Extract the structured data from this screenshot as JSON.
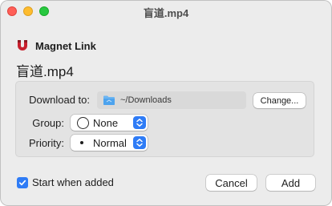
{
  "window": {
    "title": "盲道.mp4"
  },
  "header": {
    "icon": "magnet-icon",
    "title": "Magnet Link"
  },
  "file": {
    "name": "盲道.mp4"
  },
  "download": {
    "label": "Download to:",
    "icon": "folder-icon",
    "path": "~/Downloads",
    "change_label": "Change..."
  },
  "group": {
    "label": "Group:",
    "icon": "circle-icon",
    "value": "None"
  },
  "priority": {
    "label": "Priority:",
    "icon": "dot-icon",
    "value": "Normal"
  },
  "footer": {
    "start_label": "Start when added",
    "start_checked": true,
    "cancel_label": "Cancel",
    "add_label": "Add"
  },
  "colors": {
    "accent": "#2f7cf6",
    "magnet_red": "#c8202d",
    "close": "#ff5f57",
    "minimize": "#febc2e",
    "maximize": "#28c840"
  }
}
